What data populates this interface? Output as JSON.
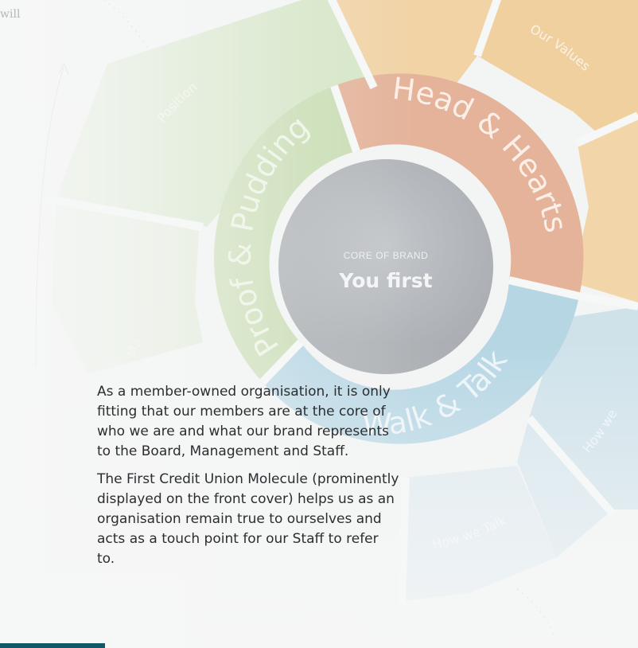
{
  "molecule": {
    "core_label": "CORE OF BRAND",
    "core_title": "You first",
    "sections": {
      "head_hearts": "Head & Hearts",
      "proof_pudding": "Proof & Pudding",
      "walk_talk": "Walk & Talk"
    },
    "segments": {
      "our_values": "Our Values",
      "position": "Position",
      "how_we_talk": "How we Talk",
      "how_we": "How we",
      "left_fragment": "Ma"
    },
    "corner_word": "will"
  },
  "text": {
    "paragraph_1": "As a member-owned organisation, it is only fitting that our members are at the core of who we are and what our brand represents to the Board, Management and Staff.",
    "paragraph_2": "The First Credit Union Molecule (prominently displayed on the front cover) helps us as an organisation remain true to ourselves and acts as a touch point for our Staff to refer to."
  }
}
